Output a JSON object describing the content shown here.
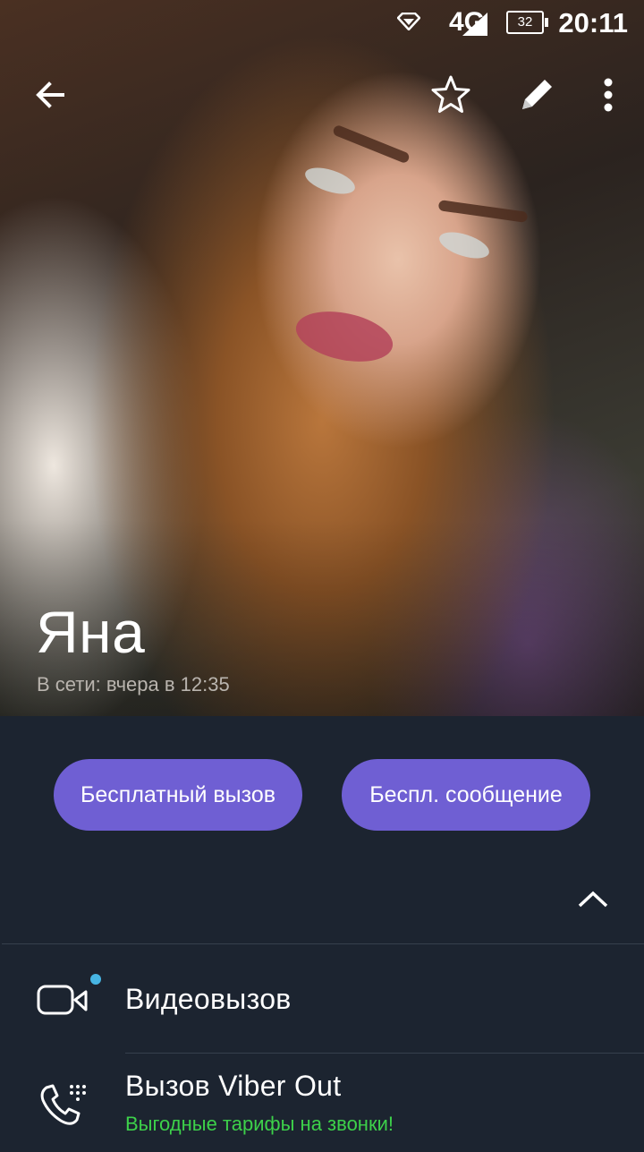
{
  "status_bar": {
    "network": "4G",
    "battery": "32",
    "time": "20:11"
  },
  "toolbar": {
    "back_icon": "arrow-left-icon",
    "favorite_icon": "star-outline-icon",
    "edit_icon": "pencil-icon",
    "more_icon": "more-vertical-icon"
  },
  "profile": {
    "name": "Яна",
    "last_seen": "В сети: вчера в 12:35"
  },
  "actions": {
    "free_call": "Бесплатный вызов",
    "free_message": "Беспл. сообщение"
  },
  "options": [
    {
      "label": "Видеовызов",
      "icon": "video-camera-icon"
    },
    {
      "label": "Вызов Viber Out",
      "subtitle": "Выгодные тарифы на звонки!",
      "icon": "phone-icon"
    }
  ],
  "colors": {
    "accent": "#6f5fd3",
    "panel_bg": "#1c2430",
    "promo_green": "#3dd14a",
    "badge_dot": "#47b5e3"
  }
}
